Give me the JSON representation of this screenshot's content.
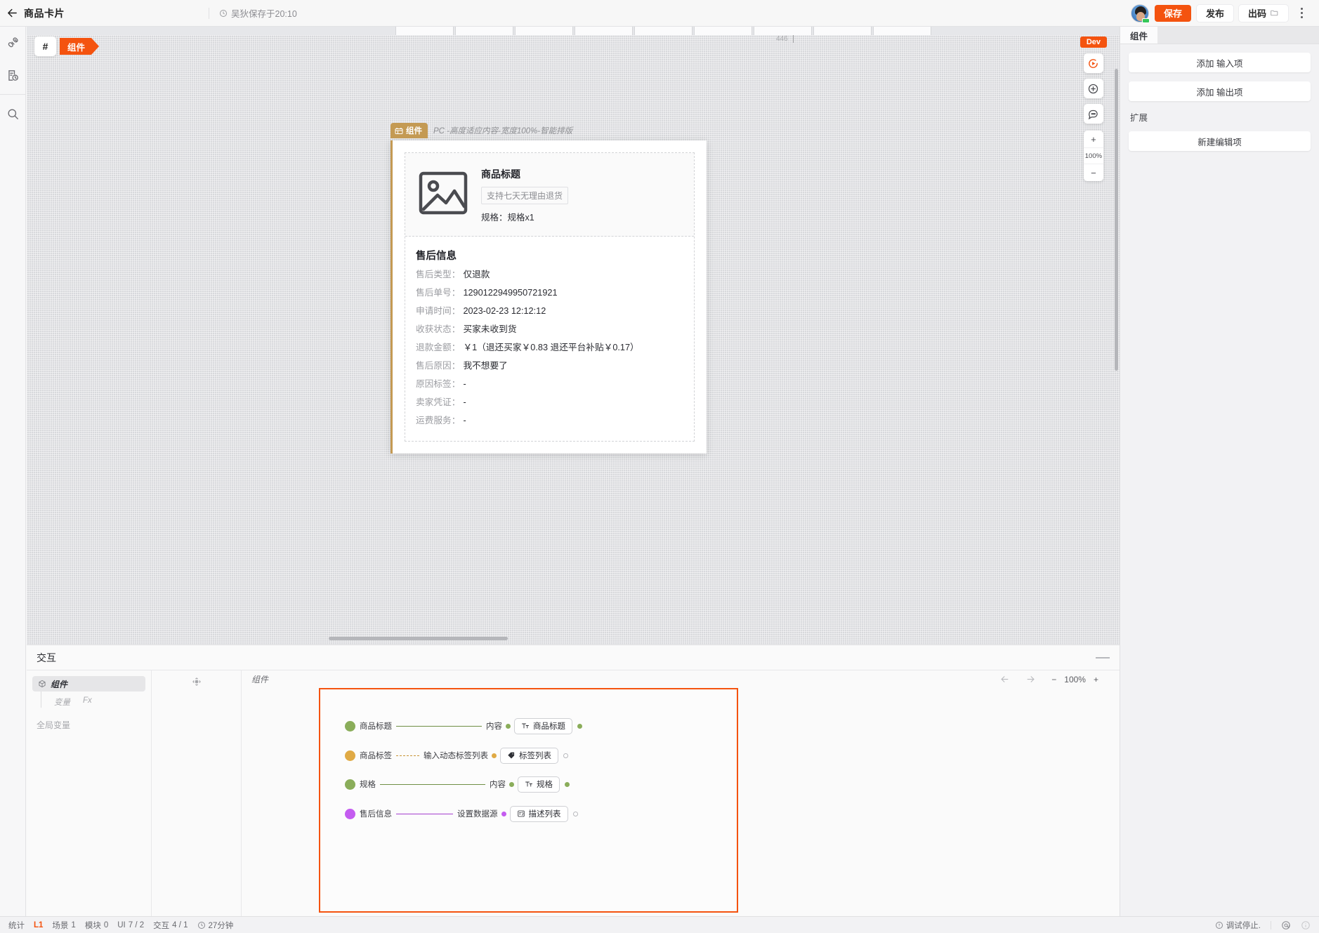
{
  "topbar": {
    "back_icon": "arrow-left-icon",
    "title": "商品卡片",
    "clock_icon": "clock-icon",
    "save_info": "吴狄保存于20:10",
    "save_label": "保存",
    "publish_label": "发布",
    "export_label": "出码",
    "export_icon": "folder-icon",
    "more_icon": "kebab-icon",
    "accent_color": "#f4530f"
  },
  "left_rail": {
    "items": [
      {
        "icon": "plugin-icon",
        "name": "rail-plugin"
      },
      {
        "icon": "history-doc-icon",
        "name": "rail-history"
      },
      {
        "icon": "search-icon",
        "name": "rail-search"
      }
    ]
  },
  "canvas": {
    "hash_chip": "#",
    "component_chip": "组件",
    "ruler_value": "446",
    "dev_badge": "Dev",
    "tools": [
      {
        "icon": "play-circle-icon",
        "name": "preview-run-button"
      },
      {
        "icon": "plus-circle-icon",
        "name": "add-circle-button"
      },
      {
        "icon": "comment-icon",
        "name": "comment-button"
      }
    ],
    "zoom_in": "+",
    "zoom_level": "100%",
    "zoom_out": "−"
  },
  "artboard": {
    "tag_icon": "component-icon",
    "tag_label": "组件",
    "meta": "PC -高度适应内容-宽度100%-智能排版",
    "product": {
      "image_icon": "image-placeholder-icon",
      "title": "商品标题",
      "tag": "支持七天无理由退货",
      "spec_label": "规格：",
      "spec_value": "规格x1"
    },
    "section_title": "售后信息",
    "fields": [
      {
        "key": "售后类型：",
        "value": "仅退款"
      },
      {
        "key": "售后单号：",
        "value": "1290122949950721921"
      },
      {
        "key": "申请时间：",
        "value": "2023-02-23 12:12:12"
      },
      {
        "key": "收获状态：",
        "value": "买家未收到货"
      },
      {
        "key": "退款金额：",
        "value": "￥1（退还买家￥0.83 退还平台补贴￥0.17）"
      },
      {
        "key": "售后原因：",
        "value": "我不想要了"
      },
      {
        "key": "原因标签：",
        "value": "-"
      },
      {
        "key": "卖家凭证：",
        "value": "-"
      },
      {
        "key": "运费服务：",
        "value": "-"
      }
    ]
  },
  "right_panel": {
    "tab_active": "组件",
    "add_input_label": "添加 输入项",
    "add_output_label": "添加 输出项",
    "extend_title": "扩展",
    "new_edit_label": "新建编辑项"
  },
  "interaction": {
    "title": "交互",
    "minimize_icon": "minimize-icon",
    "tree_node_icon": "cube-icon",
    "tree_node_label": "组件",
    "sub_variable": "变量",
    "sub_fx": "Fx",
    "global_variable": "全局变量",
    "target_icon": "target-icon",
    "graph_title": "组件",
    "nav_back_icon": "arrow-left-icon",
    "nav_forward_icon": "arrow-right-icon",
    "zoom_out": "−",
    "zoom_level": "100%",
    "zoom_in": "+",
    "nodes": [
      {
        "source": "商品标题",
        "port": "内容",
        "chip_icon": "text-style-icon",
        "chip_label": "商品标题",
        "color": "#8aad5a",
        "line_style": "solid",
        "out_filled": true
      },
      {
        "source": "商品标签",
        "port": "输入动态标签列表",
        "chip_icon": "tag-icon",
        "chip_label": "标签列表",
        "color": "#e0aa45",
        "line_style": "dashed",
        "out_filled": false
      },
      {
        "source": "规格",
        "port": "内容",
        "chip_icon": "text-style-icon",
        "chip_label": "规格",
        "color": "#8aad5a",
        "line_style": "solid",
        "out_filled": true
      },
      {
        "source": "售后信息",
        "port": "设置数据源",
        "chip_icon": "description-list-icon",
        "chip_label": "描述列表",
        "color": "#c45cf0",
        "line_style": "solid",
        "out_filled": false
      }
    ]
  },
  "statusbar": {
    "stat_label": "统计",
    "level": "L1",
    "scene_label": "场景",
    "scene_value": "1",
    "module_label": "模块",
    "module_value": "0",
    "ui_label": "UI",
    "ui_value": "7 / 2",
    "interact_label": "交互",
    "interact_value": "4 / 1",
    "clock_icon": "clock-icon",
    "duration": "27分钟",
    "debug_icon": "warning-circle-icon",
    "debug_label": "调试停止.",
    "at_icon": "at-circle-icon",
    "info_icon": "info-circle-icon"
  }
}
